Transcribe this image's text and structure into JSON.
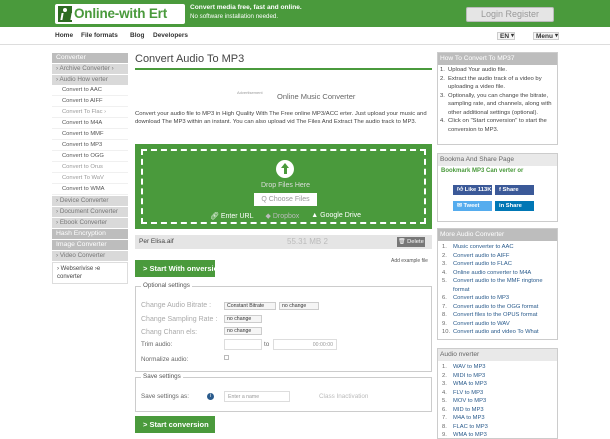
{
  "header": {
    "logo_text": "Online-with Ert",
    "tagline_1": "Convert media free, fast and online.",
    "tagline_2": "No software installation needed.",
    "login_label": "Login Register"
  },
  "nav": {
    "items": [
      "Home",
      "File formats",
      "Blog",
      "Developers"
    ],
    "language": "EN",
    "menu": "Menu"
  },
  "sidebar": {
    "sections": [
      {
        "type": "head",
        "label": "Converter"
      },
      {
        "type": "sub",
        "label": "› Archive Converter ›"
      },
      {
        "type": "sub",
        "label": "› Audio How  verter"
      },
      {
        "type": "item",
        "label": "Convert to AAC"
      },
      {
        "type": "item",
        "label": "Convert to AIFF"
      },
      {
        "type": "item",
        "label": "Convert To Flac ›",
        "faded": true
      },
      {
        "type": "item",
        "label": "Convert to M4A"
      },
      {
        "type": "item",
        "label": "Convert to MMF"
      },
      {
        "type": "item",
        "label": "Convert to MP3"
      },
      {
        "type": "item",
        "label": "Convert to OGG"
      },
      {
        "type": "item",
        "label": "Convert to Orus",
        "faded": true
      },
      {
        "type": "item",
        "label": "Convert To WaV",
        "faded": true
      },
      {
        "type": "item",
        "label": "Convert to WMA"
      },
      {
        "type": "sub",
        "label": "› Device Converter"
      },
      {
        "type": "sub",
        "label": "› Document Converter"
      },
      {
        "type": "sub",
        "label": "› Ebook Converter"
      },
      {
        "type": "head",
        "label": "Hash Encryption"
      },
      {
        "type": "head",
        "label": "Image Converter"
      },
      {
        "type": "sub",
        "label": "› Video Converter"
      }
    ],
    "footer": "› Webserivise ›e converter"
  },
  "main": {
    "title": "Convert Audio To MP3",
    "ad_label": "Advertisement",
    "ad_title": "Online Music Converter",
    "description": "Convert your audio file to MP3 in High Quality With The Free online MP3/ACC erter. Just upload your music and download The MP3 within an instant. You can also upload vid The Files And Extract The audio track to MP3.",
    "drop_text": "Drop Files Here",
    "choose_label": "Q Choose Files",
    "sources": [
      "Enter URL",
      "Dropbox",
      "Google Drive"
    ],
    "file": {
      "name": "Per Elisa.aif",
      "size": "55.31 MB 2",
      "delete_label": "Delete"
    },
    "add_example": "Add example file",
    "start_label": "Start With  onversion",
    "optional": {
      "legend": "Optional settings",
      "bitrate_label": "Change Audio Bitrate :",
      "bitrate_value": "Constant Bitrate",
      "bitrate_value2": "no change",
      "sampling_label": "Change Sampling Rate :",
      "sampling_value": "no change",
      "channels_label": "Chang  Chann  els:",
      "channels_value": "no change",
      "trim_label": "Trim audio:",
      "trim_to": "to",
      "trim_end": "00:00:00",
      "normalize_label": "Normalize audio:"
    },
    "save": {
      "legend": "Save settings",
      "label": "Save settings as:",
      "placeholder": "Enter a name",
      "class": "Class Inactivation"
    },
    "start_label2": "Start  conversion"
  },
  "right": {
    "how_title": "How To Convert To MP37",
    "steps": [
      "Upload Your audio file.",
      "Extract the audio track of a video by uploading a video file.",
      "Optionally, you can change the bitrate, sampling rate, and channels, along with other additional settings (optional).",
      "Click on \"Start conversion\" to start the conversion to MP3."
    ],
    "bookmark_title": "Bookma   And Share Page",
    "bookmark_line": "Bookmark MP3 Can verter or",
    "social": {
      "like": "Like 113K",
      "share_fb": "Share",
      "tweet": "Tweet",
      "share_in": "Share"
    },
    "more_title": "More Audio Converter",
    "more": [
      "Music converter to AAC",
      "Convert audio to AIFF",
      "Convert audio to FLAC",
      "Online audio converter to M4A",
      "Convert audio to the MMF ringtone format",
      "Convert audio to MP3",
      "Convert audio to the OGG format",
      "Convert files to the OPUS format",
      "Convert audio to WAV",
      "Convert audio and video To What"
    ],
    "audio_title": "Audio  nverter",
    "audio_list": [
      "WAV to MP3",
      "MIDI to MP3",
      "WMA to MP3",
      "FLV to MP3",
      "MOV to MP3",
      "MID to MP3",
      "M4A to MP3",
      "FLAC to MP3",
      "WMA to MP3"
    ]
  }
}
